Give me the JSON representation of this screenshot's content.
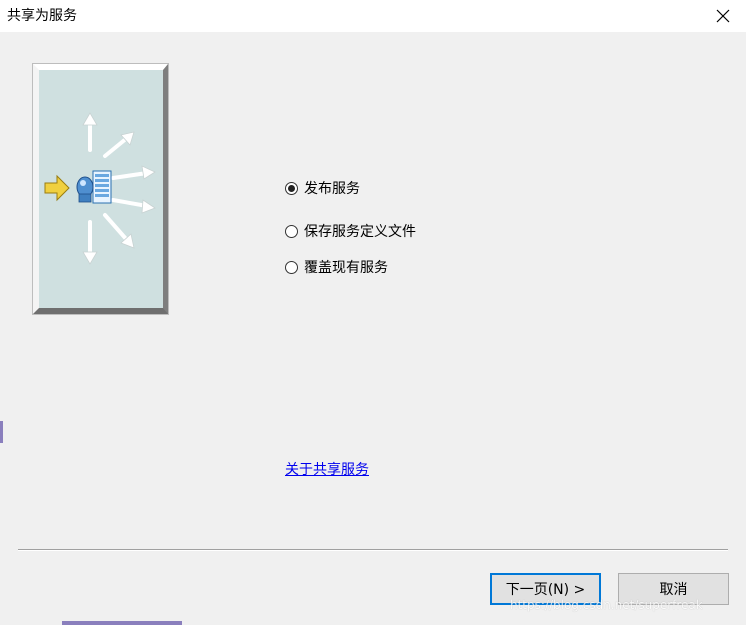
{
  "window": {
    "title": "共享为服务"
  },
  "options": [
    {
      "label": "发布服务",
      "checked": true
    },
    {
      "label": "保存服务定义文件",
      "checked": false
    },
    {
      "label": "覆盖现有服务",
      "checked": false
    }
  ],
  "link": {
    "label": "关于共享服务"
  },
  "buttons": {
    "next_label": "下一页(N) >",
    "cancel_label": "取消"
  },
  "watermark": "https://blog.csdn.net/superfreak",
  "icons": {
    "close": "close-icon",
    "illustration": "share-service-illustration"
  },
  "colors": {
    "focus_border": "#0078d7",
    "link": "#0000ee",
    "illustration_bg": "#cfe0e0"
  }
}
